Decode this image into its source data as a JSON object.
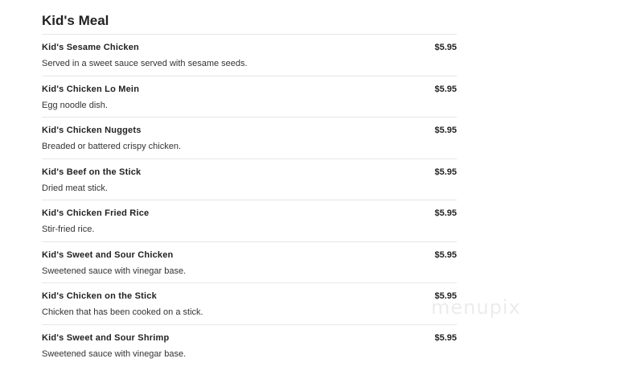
{
  "section": {
    "title": "Kid's Meal",
    "items": [
      {
        "name": "Kid's Sesame Chicken",
        "price": "$5.95",
        "description": "Served in a sweet sauce served with sesame seeds."
      },
      {
        "name": "Kid's Chicken Lo Mein",
        "price": "$5.95",
        "description": "Egg noodle dish."
      },
      {
        "name": "Kid's Chicken Nuggets",
        "price": "$5.95",
        "description": "Breaded or battered crispy chicken."
      },
      {
        "name": "Kid's Beef on the Stick",
        "price": "$5.95",
        "description": "Dried meat stick."
      },
      {
        "name": "Kid's Chicken Fried Rice",
        "price": "$5.95",
        "description": "Stir-fried rice."
      },
      {
        "name": "Kid's Sweet and Sour Chicken",
        "price": "$5.95",
        "description": "Sweetened sauce with vinegar base."
      },
      {
        "name": "Kid's Chicken on the Stick",
        "price": "$5.95",
        "description": "Chicken that has been cooked on a stick."
      },
      {
        "name": "Kid's Sweet and Sour Shrimp",
        "price": "$5.95",
        "description": "Sweetened sauce with vinegar base."
      }
    ]
  },
  "watermark": "menupix"
}
